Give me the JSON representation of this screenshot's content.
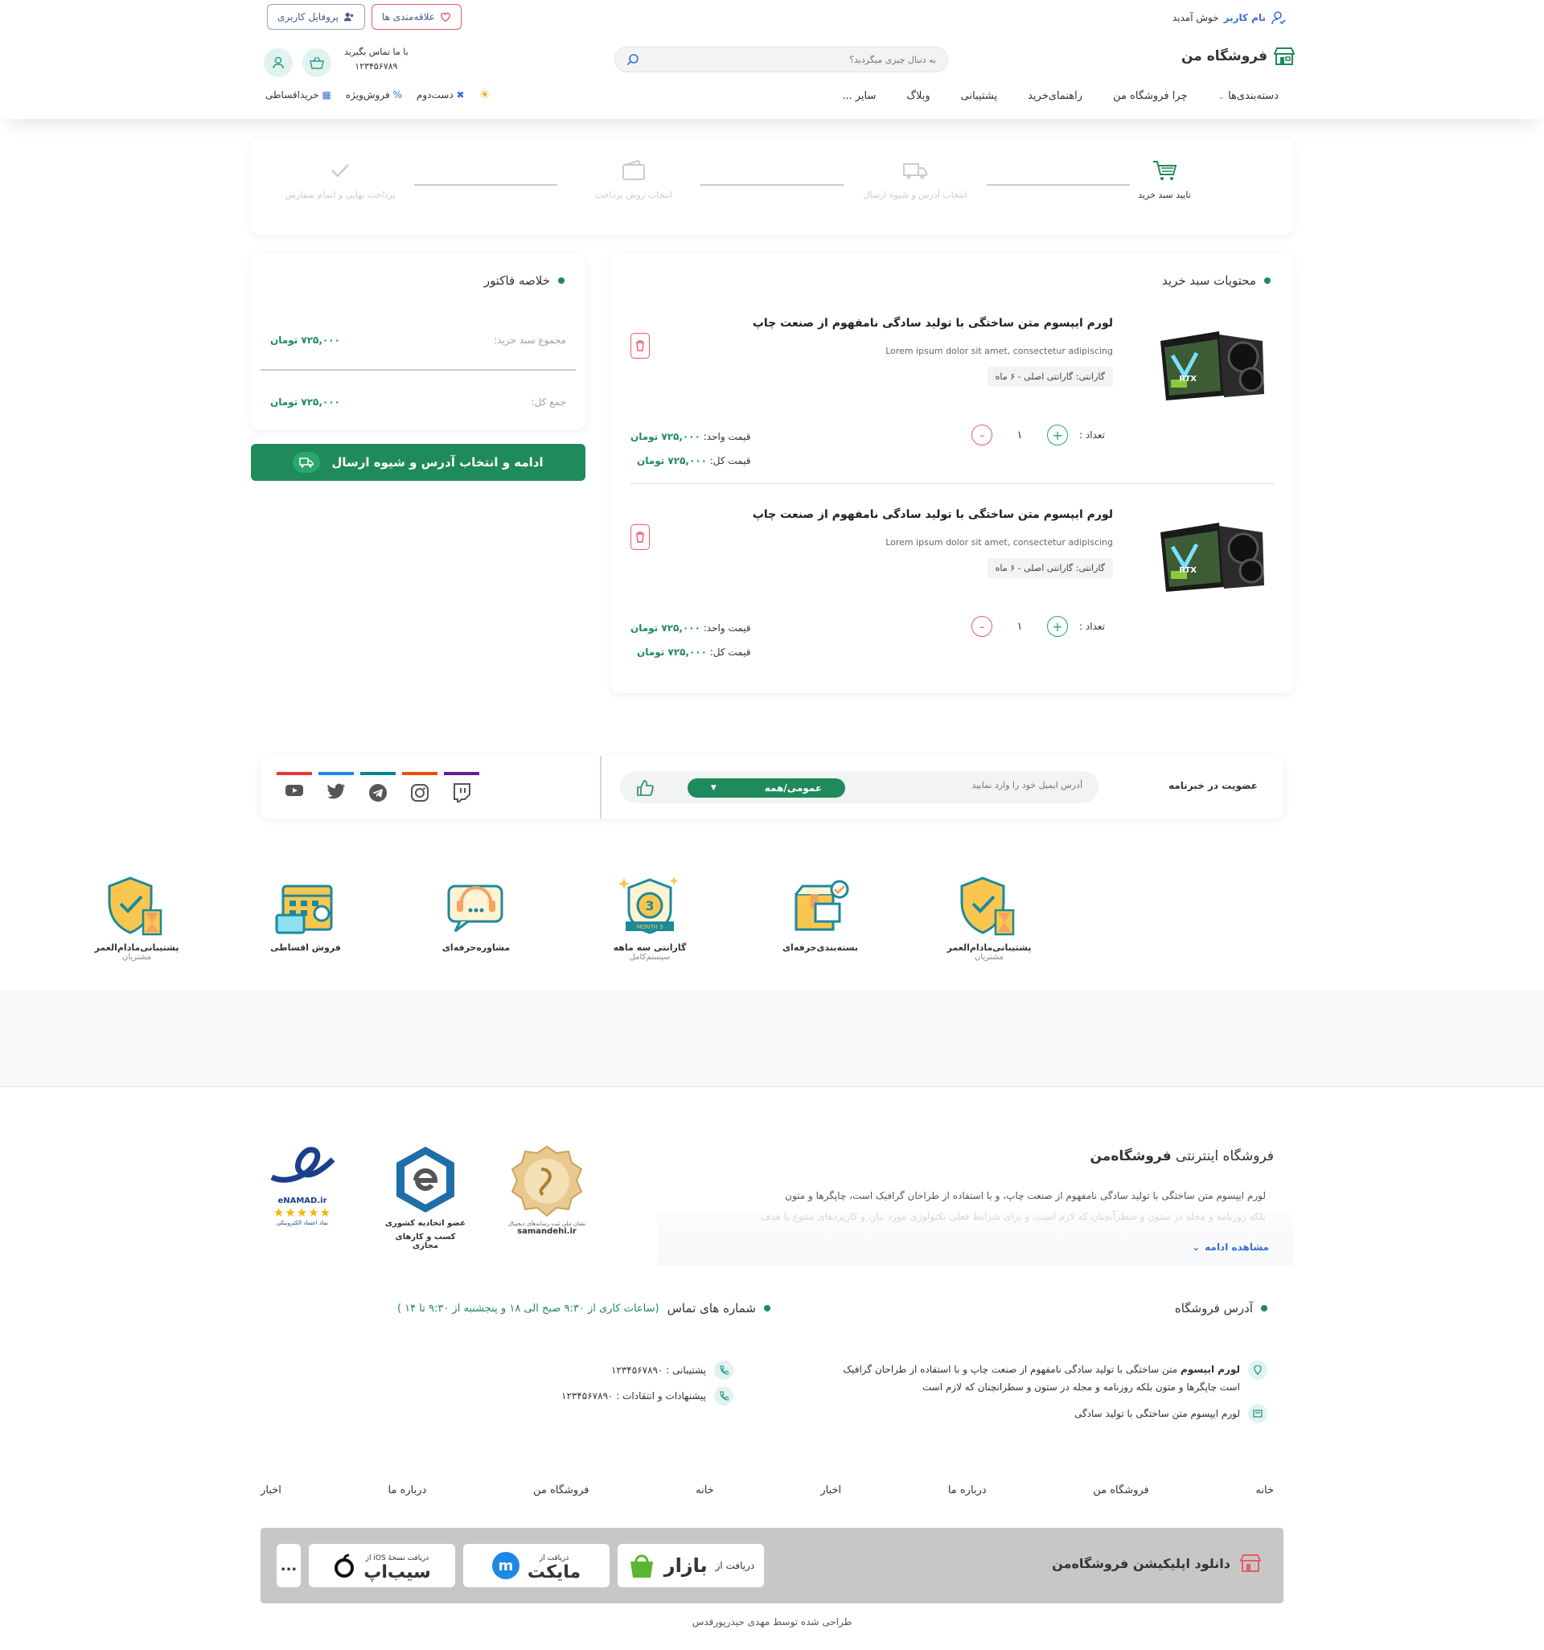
{
  "topbar": {
    "welcome_user": "نام کاربر",
    "welcome_text": "خوش آمدید",
    "profile_button": "پروفایل کاربری",
    "wishlist_button": "علاقه‌مندی ها"
  },
  "header": {
    "logo_text": "فروشگاه من",
    "search_placeholder": "به دنبال چیزی میگردید؟",
    "contact_label": "با ما تماس بگیرید",
    "contact_phone": "۱۲۳۴۵۶۷۸۹",
    "nav": [
      "دسته‌بندی‌ها",
      "چرا فروشگاه من",
      "راهنمای‌خرید",
      "پشتیبانی",
      "وبلاگ",
      "سایر ..."
    ],
    "quick_links": [
      "خریداقساطی",
      "فروش‌ویژه",
      "دست‌دوم"
    ]
  },
  "steps": [
    {
      "label": "تایید سبد خرید",
      "active": true
    },
    {
      "label": "انتخاب آدرس و شیوه ارسال",
      "active": false
    },
    {
      "label": "انتخاب روش پرداخت",
      "active": false
    },
    {
      "label": "پرداخت نهایی و اتمام سفارش",
      "active": false
    }
  ],
  "cart": {
    "title": "محتویات سبد خرید",
    "items": [
      {
        "title": "لورم ایپسوم متن ساختگی با تولید سادگی نامفهوم از صنعت چاپ",
        "subtitle": "Lorem ipsum dolor sit amet, consectetur adipiscing",
        "guarantee": "گارانتی: گارانتی اصلی - ۶ ماه",
        "qty_label": "تعداد :",
        "qty": "۱",
        "unit_price_label": "قیمت واحد:",
        "unit_price": "۷۲۵,۰۰۰ تومان",
        "total_price_label": "قیمت کل:",
        "total_price": "۷۲۵,۰۰۰ تومان"
      },
      {
        "title": "لورم ایپسوم متن ساختگی با تولید سادگی نامفهوم از صنعت چاپ",
        "subtitle": "Lorem ipsum dolor sit amet, consectetur adipiscing",
        "guarantee": "گارانتی: گارانتی اصلی - ۶ ماه",
        "qty_label": "تعداد :",
        "qty": "۱",
        "unit_price_label": "قیمت واحد:",
        "unit_price": "۷۲۵,۰۰۰ تومان",
        "total_price_label": "قیمت کل:",
        "total_price": "۷۲۵,۰۰۰ تومان"
      }
    ]
  },
  "summary": {
    "title": "خلاصه فاکتور",
    "subtotal_label": "مجموع سبد خرید:",
    "subtotal": "۷۲۵,۰۰۰ تومان",
    "total_label": "جمع کل:",
    "total": "۷۲۵,۰۰۰ تومان",
    "cta": "ادامه و انتخاب آدرس و شیوه ارسال"
  },
  "newsletter": {
    "title": "عضویت در خبرنامه",
    "placeholder": "آدرس ایمیل خود را وارد نمایید",
    "select_value": "عمومی/همه"
  },
  "social": [
    {
      "icon": "youtube-icon",
      "color": "#e53935"
    },
    {
      "icon": "twitter-icon",
      "color": "#1e88e5"
    },
    {
      "icon": "telegram-icon",
      "color": "#00838f"
    },
    {
      "icon": "instagram-icon",
      "color": "#e65100"
    },
    {
      "icon": "twitch-icon",
      "color": "#6a1b9a"
    }
  ],
  "features": [
    {
      "label": "پشتیبانی‌مادام‌العمر",
      "sub": "مشتریان"
    },
    {
      "label": "بسته‌بندی‌حرفه‌ای",
      "sub": ""
    },
    {
      "label": "گارانتی سه ماهه",
      "sub": "سیستم‌کامل",
      "badge": "3 MONTH"
    },
    {
      "label": "مشاوره‌حرفه‌ای",
      "sub": ""
    },
    {
      "label": "فروش اقساطی",
      "sub": ""
    },
    {
      "label": "پشتیبانی‌مادام‌العمر",
      "sub": "مشتریان"
    }
  ],
  "about": {
    "title_prefix": "فروشگاه اینترنتی",
    "title_brand": "فروشگاه‌من",
    "line1": "لورم ایپسوم متن ساختگی با تولید سادگی نامفهوم از صنعت چاپ، و با استفاده از طراحان گرافیک است، چاپگرها و متون",
    "line2": "بلکه روزنامه و مجله در ستون و سطرآنچنان که لازم است، و برای شرایط فعلی تکنولوژی مورد نیاز، و کاربردهای متنوع با هدف",
    "more": "مشاهده ادامه"
  },
  "badges": {
    "samandehi": "samandehi.ir",
    "samandehi_caption": "نشان ملی ثبت رسانه‌های دیجیتال",
    "etehadieh_line1": "عضو اتحادیه کشوری",
    "etehadieh_line2": "کسب و کارهای مجازی",
    "enamad": "eNAMAD.ir",
    "enamad_caption": "نماد اعتماد الکترونیکی"
  },
  "contact": {
    "address_title": "آدرس فروشگاه",
    "address_bold": "لورم ایپسوم",
    "address_text": "متن ساختگی با تولید سادگی نامفهوم از صنعت چاپ و با استفاده از طراحان گرافیک",
    "address_text2": "است چاپگرها و متون بلکه روزنامه و مجله در ستون و سطرانچنان که لازم است",
    "postal_text": "لورم ایپسوم متن ساختگی با تولید سادگی",
    "phones_title": "شماره های تماس",
    "phones_hours": "(ساعات کاری از ۹:۳۰ صبح الی ۱۸ و پنجشنبه از ۹:۳۰ تا ۱۴ )",
    "support": "پشتیبانی : ۱۲۳۴۵۶۷۸۹۰",
    "feedback": "پیشنهادات و انتقادات : ۱۲۳۴۵۶۷۸۹۰"
  },
  "footer_links": [
    "خانه",
    "فروشگاه من",
    "درباره ما",
    "اخبار",
    "خانه",
    "فروشگاه من",
    "درباره ما",
    "اخبار"
  ],
  "app": {
    "title": "دانلود اپلیکیشن فروشگاه‌من",
    "bazaar_prefix": "دریافت از",
    "bazaar_name": "بازار",
    "myket_prefix": "دریافت از",
    "myket_name": "مایکت",
    "sibapp_prefix": "دریافت نسخهٔ iOS از",
    "sibapp_name": "سیب‌اپ",
    "more": "..."
  },
  "credit": "طراحی شده توسط مهدی حیدرپورقدس"
}
